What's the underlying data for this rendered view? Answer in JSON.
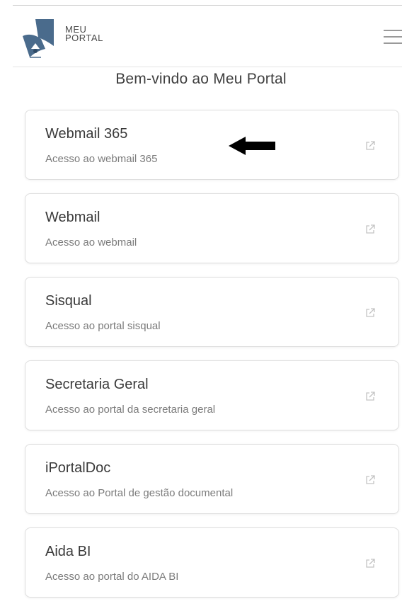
{
  "header": {
    "brand_line1": "MEU",
    "brand_line2": "PORTAL",
    "logo_icon": "portal-logo-icon",
    "menu_icon": "hamburger-menu-icon"
  },
  "welcome": "Bem-vindo ao Meu Portal",
  "colors": {
    "logo_blue": "#4a6b8c",
    "card_border": "#dedede",
    "text_primary": "#3a3a3a",
    "text_secondary": "#7b7b7b"
  },
  "cards": [
    {
      "title": "Webmail 365",
      "description": "Acesso ao webmail 365",
      "icon": "external-link-icon"
    },
    {
      "title": "Webmail",
      "description": "Acesso ao webmail",
      "icon": "external-link-icon"
    },
    {
      "title": "Sisqual",
      "description": "Acesso ao portal sisqual",
      "icon": "external-link-icon"
    },
    {
      "title": "Secretaria Geral",
      "description": "Acesso ao portal da secretaria geral",
      "icon": "external-link-icon"
    },
    {
      "title": "iPortalDoc",
      "description": "Acesso ao Portal de gestão documental",
      "icon": "external-link-icon"
    },
    {
      "title": "Aida BI",
      "description": "Acesso ao portal do AIDA BI",
      "icon": "external-link-icon"
    }
  ],
  "annotation": {
    "icon": "arrow-left-icon"
  }
}
